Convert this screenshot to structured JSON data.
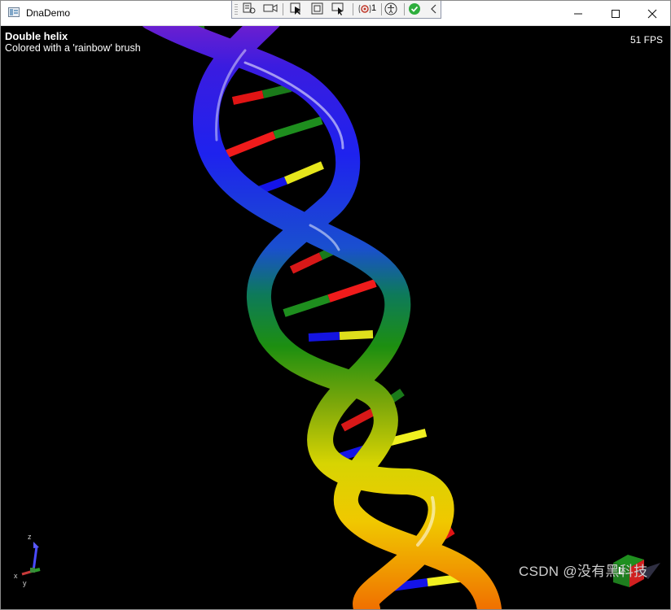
{
  "window": {
    "title": "DnaDemo",
    "minimize_icon": "minimize-icon",
    "maximize_icon": "maximize-icon",
    "close_icon": "close-icon"
  },
  "debug_toolbar": {
    "tools": [
      "live-visual-tree-icon",
      "select-element-icon",
      "camera-icon",
      "select-in-app-icon",
      "display-layout-adorners-icon",
      "track-focus-icon",
      "binding-failures-icon",
      "accessibility-icon",
      "checkmark-icon",
      "collapse-chevron-icon"
    ],
    "binding_failure_count": "1"
  },
  "scene": {
    "title": "Double helix",
    "subtitle": "Colored with a 'rainbow' brush",
    "fps": "51 FPS",
    "background": "#000000",
    "coordinate_system": {
      "x": "x",
      "y": "y",
      "z": "z"
    },
    "view_cube_face_label": "L"
  },
  "watermark": "CSDN @没有黑科技",
  "colors": {
    "titlebar": "#ffffff",
    "base_pair_colors": [
      "#ff1a1a",
      "#1f8f1f",
      "#1a1aff",
      "#f0f020"
    ]
  }
}
